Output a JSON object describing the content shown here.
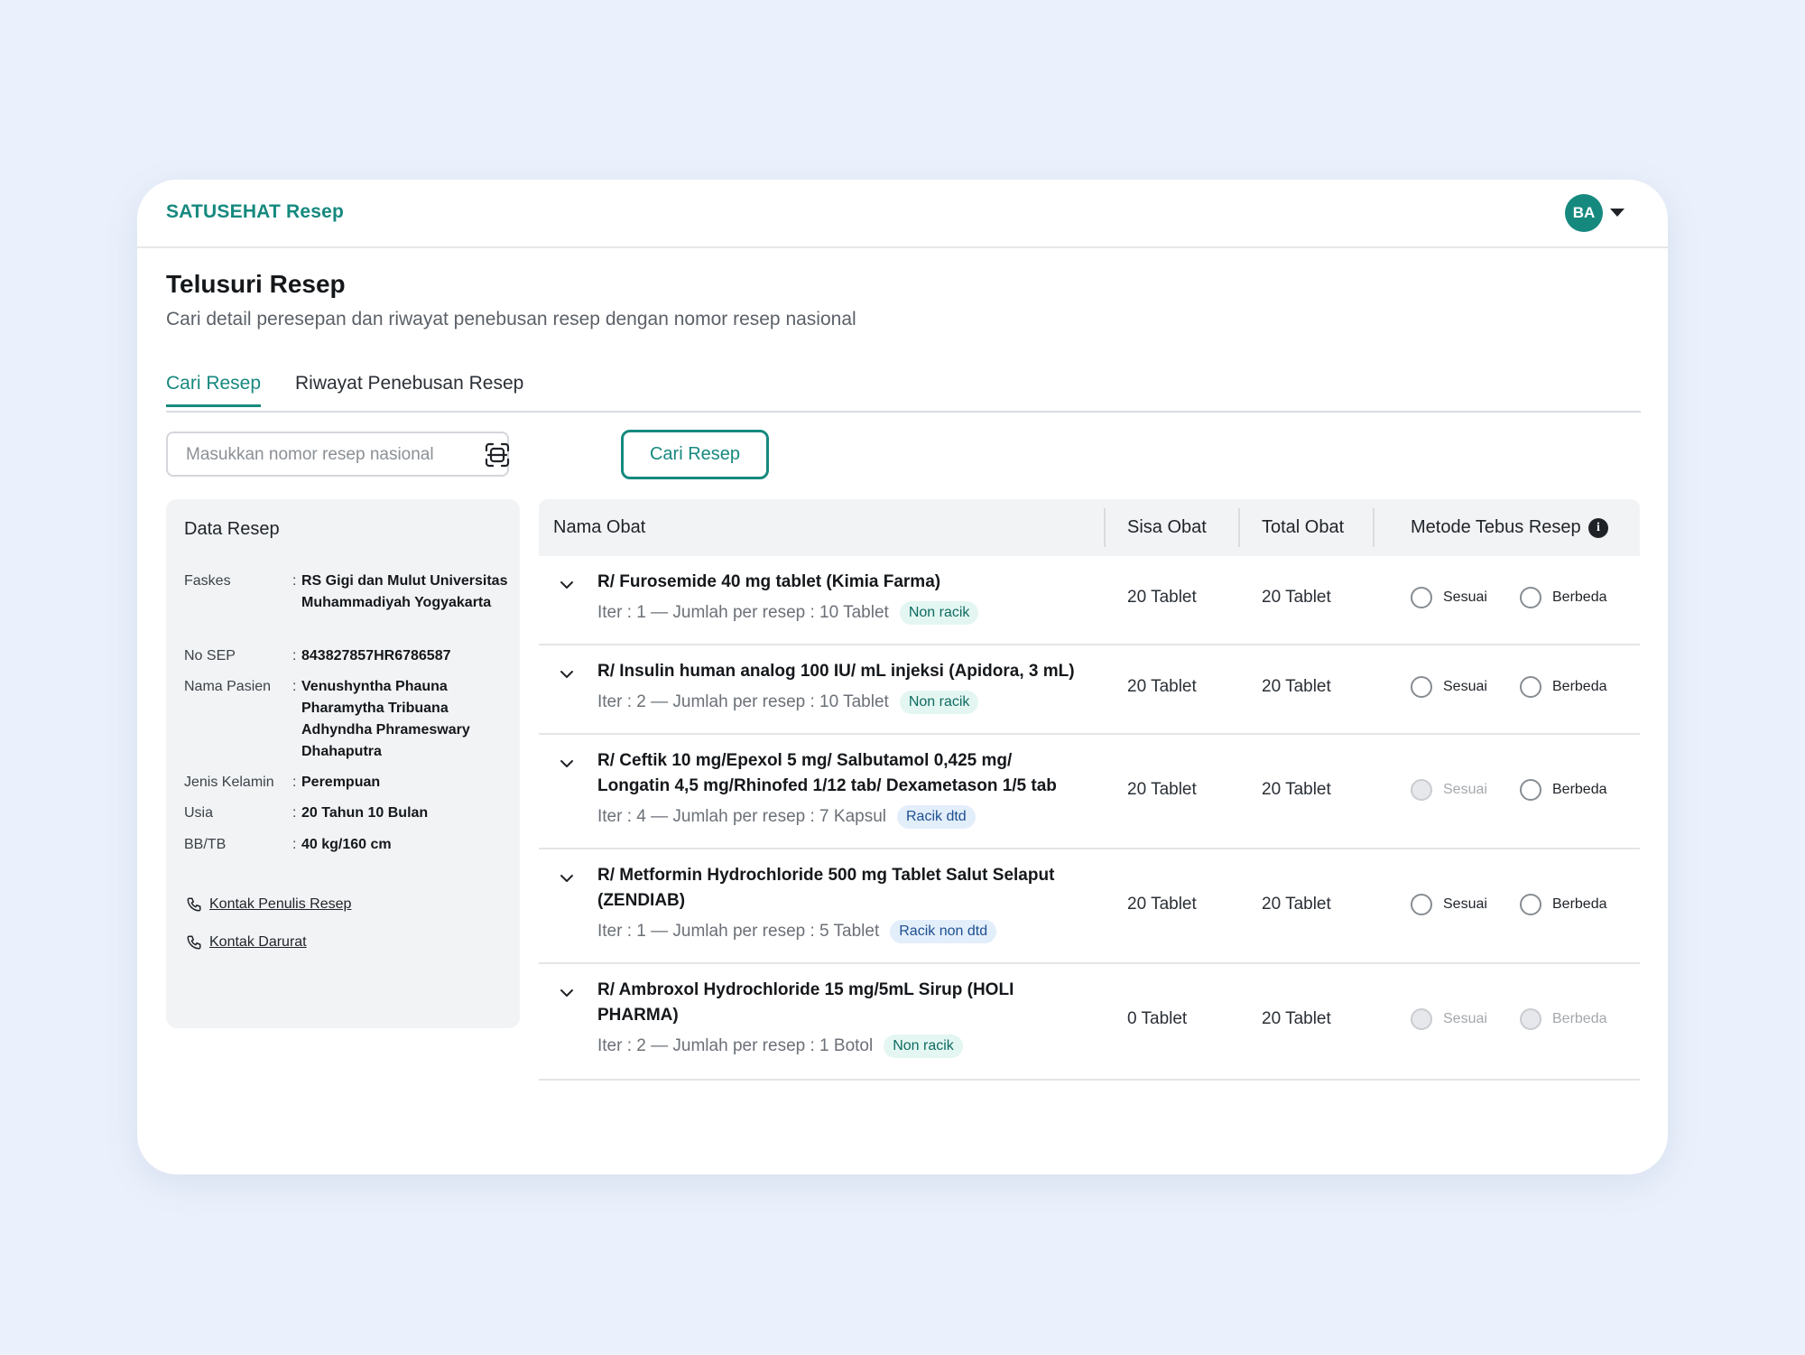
{
  "app": {
    "brand": "SATUSEHAT Resep",
    "avatar_initials": "BA"
  },
  "page": {
    "title": "Telusuri Resep",
    "subtitle": "Cari detail peresepan dan riwayat penebusan resep dengan nomor resep nasional"
  },
  "tabs": [
    {
      "label": "Cari Resep",
      "active": true
    },
    {
      "label": "Riwayat Penebusan Resep",
      "active": false
    }
  ],
  "search": {
    "placeholder": "Masukkan nomor resep nasional",
    "value": "",
    "button_label": "Cari Resep"
  },
  "panel": {
    "title": "Data Resep",
    "fields": [
      {
        "label": "Faskes",
        "value": "RS Gigi dan Mulut Universitas Muhammadiyah Yogyakarta"
      },
      {
        "label": "No SEP",
        "value": "843827857HR6786587"
      },
      {
        "label": "Nama Pasien",
        "value": "Venushyntha Phauna Pharamytha Tribuana Adhyndha Phrameswary Dhahaputra"
      },
      {
        "label": "Jenis Kelamin",
        "value": "Perempuan"
      },
      {
        "label": "Usia",
        "value": "20 Tahun 10 Bulan"
      },
      {
        "label": "BB/TB",
        "value": "40 kg/160 cm"
      }
    ],
    "contacts": [
      "Kontak Penulis Resep",
      "Kontak Darurat"
    ]
  },
  "table": {
    "headers": {
      "nama": "Nama Obat",
      "sisa": "Sisa Obat",
      "total": "Total Obat",
      "metode": "Metode Tebus Resep"
    },
    "radio_labels": {
      "sesuai": "Sesuai",
      "berbeda": "Berbeda"
    },
    "rows": [
      {
        "name": "R/ Furosemide 40 mg tablet (Kimia Farma)",
        "meta": "Iter : 1 — Jumlah per resep : 10 Tablet",
        "badge": "Non racik",
        "badge_type": "green",
        "sisa": "20 Tablet",
        "total": "20 Tablet",
        "sesuai_enabled": true,
        "berbeda_enabled": true
      },
      {
        "name": "R/ Insulin human analog 100 IU/ mL injeksi (Apidora, 3 mL)",
        "meta": "Iter : 2 — Jumlah per resep : 10 Tablet",
        "badge": "Non racik",
        "badge_type": "green",
        "sisa": "20 Tablet",
        "total": "20 Tablet",
        "sesuai_enabled": true,
        "berbeda_enabled": true
      },
      {
        "name": "R/ Ceftik 10 mg/Epexol 5 mg/ Salbutamol 0,425 mg/ Longatin 4,5 mg/Rhinofed 1/12 tab/ Dexametason 1/5 tab",
        "meta": "Iter : 4 — Jumlah per resep : 7 Kapsul",
        "badge": "Racik dtd",
        "badge_type": "blue",
        "sisa": "20 Tablet",
        "total": "20 Tablet",
        "sesuai_enabled": false,
        "berbeda_enabled": true
      },
      {
        "name": "R/ Metformin Hydrochloride 500 mg Tablet Salut Selaput (ZENDIAB)",
        "meta": "Iter : 1 — Jumlah per resep : 5 Tablet",
        "badge": "Racik non dtd",
        "badge_type": "blue",
        "sisa": "20 Tablet",
        "total": "20 Tablet",
        "sesuai_enabled": true,
        "berbeda_enabled": true
      },
      {
        "name": "R/ Ambroxol Hydrochloride 15 mg/5mL Sirup (HOLI PHARMA)",
        "meta": "Iter : 2 — Jumlah per resep : 1 Botol",
        "badge": "Non racik",
        "badge_type": "green",
        "sisa": "0 Tablet",
        "total": "20 Tablet",
        "sesuai_enabled": false,
        "berbeda_enabled": false
      }
    ]
  },
  "colors": {
    "brand": "#16897f",
    "background": "#ebf1fc",
    "badge_green_bg": "#e4f6f2",
    "badge_blue_bg": "#e3eefb"
  },
  "icons": [
    "scan-icon",
    "info-icon",
    "chevron-down-icon",
    "phone-icon",
    "caret-down-icon"
  ]
}
